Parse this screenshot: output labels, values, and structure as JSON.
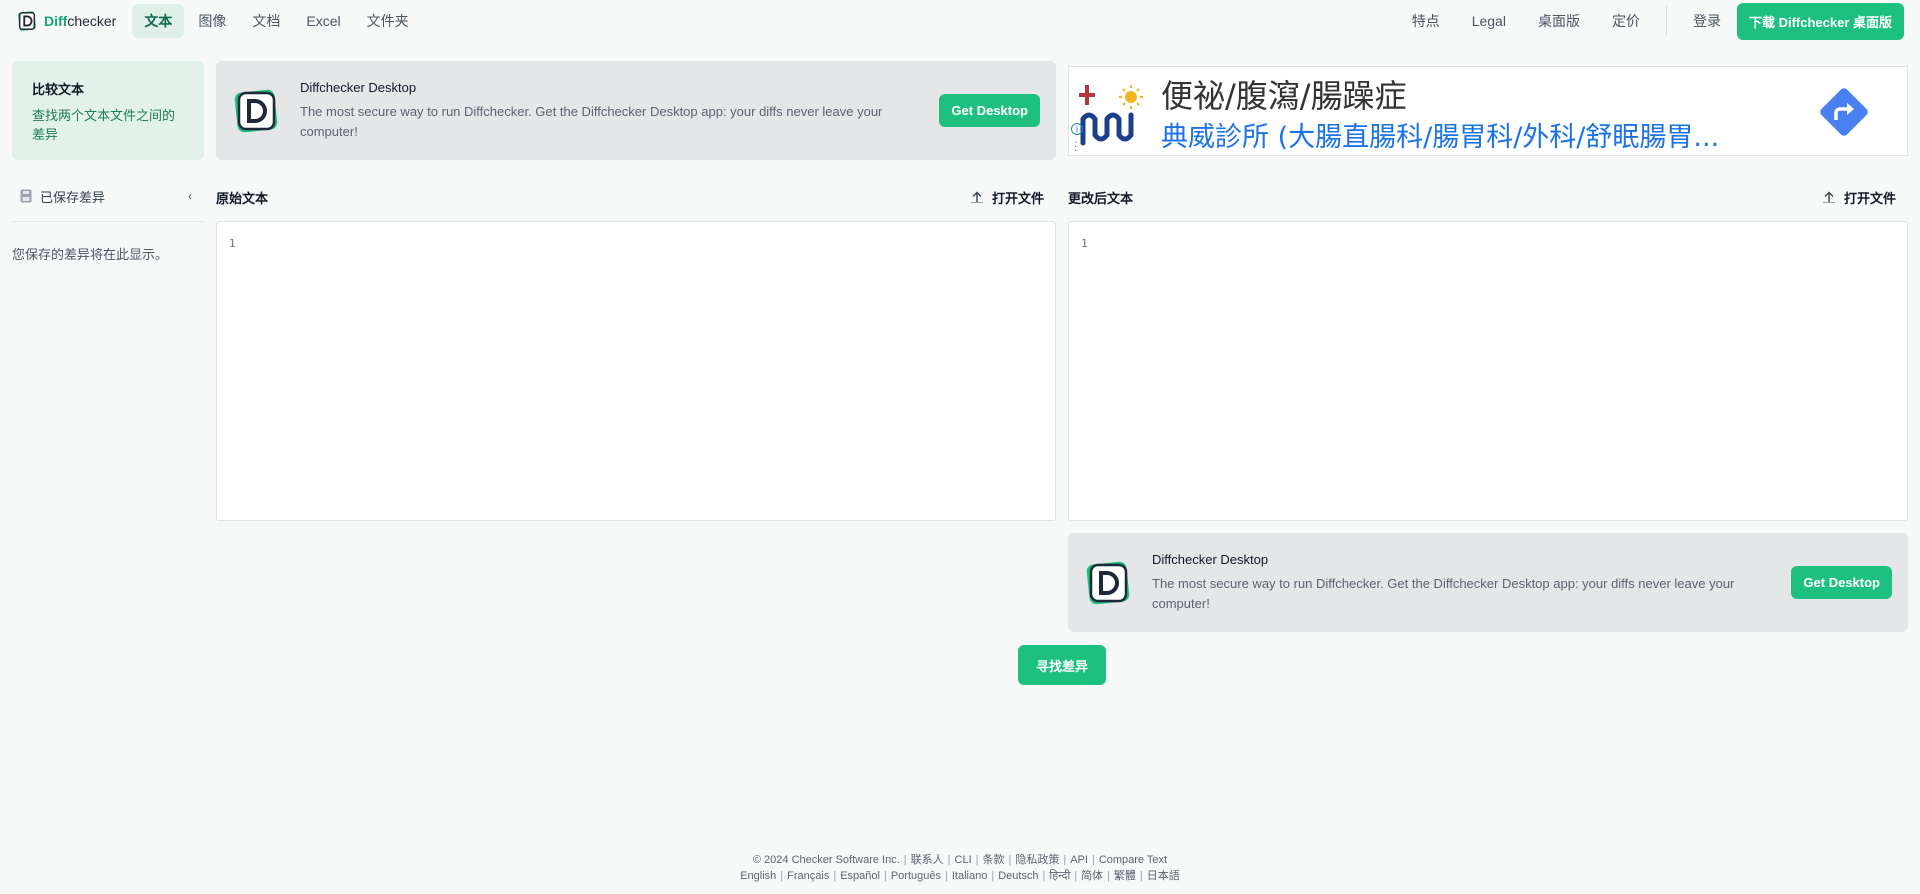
{
  "nav": {
    "brand_diff": "Diff",
    "brand_checker": "checker",
    "tabs": [
      {
        "label": "文本",
        "active": true
      },
      {
        "label": "图像",
        "active": false
      },
      {
        "label": "文档",
        "active": false
      },
      {
        "label": "Excel",
        "active": false
      },
      {
        "label": "文件夹",
        "active": false
      }
    ],
    "links": [
      "特点",
      "Legal",
      "桌面版",
      "定价"
    ],
    "login": "登录",
    "download": "下载 Diffchecker 桌面版"
  },
  "sidebar": {
    "card_title": "比较文本",
    "card_desc": "查找两个文本文件之间的差异",
    "saved_label": "已保存差异",
    "saved_empty": "您保存的差异将在此显示。"
  },
  "promo": {
    "title": "Diffchecker Desktop",
    "desc": "The most secure way to run Diffchecker. Get the Diffchecker Desktop app: your diffs never leave your computer!",
    "button": "Get Desktop"
  },
  "ad": {
    "title": "便祕/腹瀉/腸躁症",
    "subtitle": "典威診所 (大腸直腸科/腸胃科/外科/舒眠腸胃..."
  },
  "editors": {
    "left_title": "原始文本",
    "right_title": "更改后文本",
    "open_file": "打开文件",
    "line_number": "1"
  },
  "find_button": "寻找差异",
  "footer": {
    "row1": [
      "© 2024 Checker Software Inc.",
      "联系人",
      "CLI",
      "条款",
      "隐私政策",
      "API",
      "Compare Text"
    ],
    "row2": [
      "English",
      "Français",
      "Español",
      "Português",
      "Italiano",
      "Deutsch",
      "हिन्दी",
      "简体",
      "繁體",
      "日本語"
    ]
  },
  "colors": {
    "accent": "#1ec07f",
    "accent_dark": "#12694f",
    "sidebar_card_bg": "#e2f1ea",
    "promo_bg": "#e5e6e8"
  }
}
